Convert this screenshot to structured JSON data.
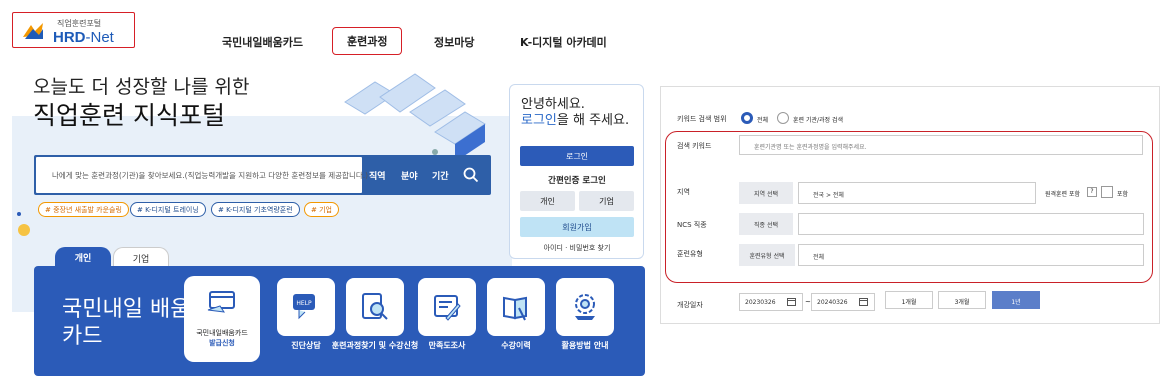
{
  "header": {
    "logo_small": "직업훈련포털",
    "logo_hrd": "HRD",
    "logo_net": "-Net",
    "nav": [
      "국민내일배움카드",
      "훈련과정",
      "정보마당",
      "K-디지털 아카데미"
    ],
    "active_nav": "훈련과정"
  },
  "hero": {
    "tagline": "오늘도 더 성장할 나를 위한",
    "title": "직업훈련 지식포털"
  },
  "search": {
    "placeholder": "나에게 맞는 훈련과정(기관)을 찾아보세요.(직업능력개발을 지원하고 다양한 훈련정보를 제공합니다.)",
    "filters": [
      "직역",
      "분야",
      "기간"
    ]
  },
  "chips": [
    "# 중장년 새출발 카운슬링",
    "# K-디지털 트레이닝",
    "# K-디지털 기초역량훈련",
    "# 기업"
  ],
  "tabs": {
    "personal": "개인",
    "company": "기업"
  },
  "card": {
    "title": "국민내일 배움카드",
    "services": [
      {
        "label": "국민내일배움카드",
        "sub": "발급신청",
        "icon": "card-icon"
      },
      {
        "label": "진단상담",
        "icon": "help-icon"
      },
      {
        "label": "훈련과정찾기 및 수강신청",
        "icon": "search-doc-icon"
      },
      {
        "label": "만족도조사",
        "icon": "survey-icon"
      },
      {
        "label": "수강이력",
        "icon": "book-icon"
      },
      {
        "label": "활용방법 안내",
        "icon": "gear-icon"
      }
    ]
  },
  "login": {
    "greeting": "안녕하세요.",
    "prompt_link": "로그인",
    "prompt_rest": "을 해 주세요.",
    "login_button": "로그인",
    "easy_login": "간편인증 로그인",
    "personal": "개인",
    "company": "기업",
    "join": "회원가입",
    "find": "아이디 · 비밀번호 찾기"
  },
  "search_panel": {
    "scope_label": "키워드 검색 범위",
    "scope_options": [
      "전체",
      "훈련 기관/과정 검색"
    ],
    "keyword_label": "검색 키워드",
    "keyword_placeholder": "훈련기관명 또는 훈련과정명을 입력해주세요.",
    "region_label": "지역",
    "region_button": "지역 선택",
    "region_value": "전국 > 전체",
    "remote_label": "원격훈련 포함",
    "remote_help": "?",
    "remote_include": "포함",
    "ncs_label": "NCS 직종",
    "ncs_button": "직종 선택",
    "type_label": "훈련유형",
    "type_button": "훈련유형 선택",
    "type_value": "전체",
    "date_label": "개강일자",
    "date_start": "20230326",
    "date_sep": "~",
    "date_end": "20240326",
    "periods": [
      "1개월",
      "3개월",
      "1년"
    ],
    "active_period": "1년"
  }
}
